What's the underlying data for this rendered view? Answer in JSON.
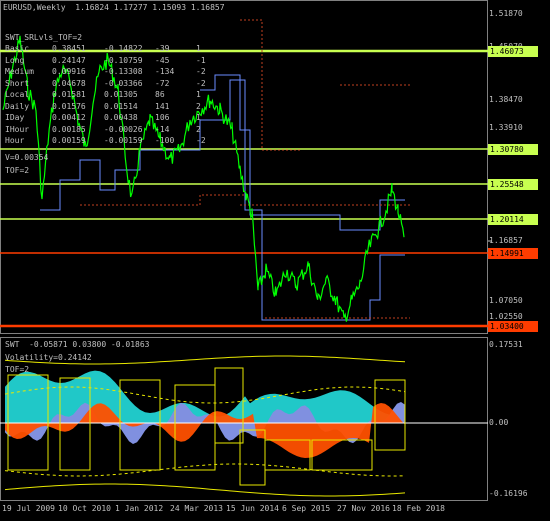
{
  "main_panel": {
    "header": "EURUSD,Weekly  1.16824 1.17277 1.15093 1.16857",
    "indicator_title": "SWT_SRLvls_TOF=2",
    "table_rows": [
      {
        "name": "Basic",
        "c1": "0.38451",
        "c2": "-0.14822",
        "c3": "-39",
        "c4": "1"
      },
      {
        "name": "Long",
        "c1": "0.24147",
        "c2": "-0.10759",
        "c3": "-45",
        "c4": "-1"
      },
      {
        "name": "Medium",
        "c1": "0.09916",
        "c2": "-0.13308",
        "c3": "-134",
        "c4": "-2"
      },
      {
        "name": "Short",
        "c1": "0.04678",
        "c2": "-0.03366",
        "c3": "-72",
        "c4": "-2"
      },
      {
        "name": "Local",
        "c1": "0.01581",
        "c2": "0.01305",
        "c3": "86",
        "c4": "1"
      },
      {
        "name": "Daily",
        "c1": "0.01576",
        "c2": "0.01514",
        "c3": "141",
        "c4": "2"
      },
      {
        "name": "IDay",
        "c1": "0.00412",
        "c2": "0.00438",
        "c3": "106",
        "c4": "1"
      },
      {
        "name": "IHour",
        "c1": "0.00185",
        "c2": "-0.00026",
        "c3": "-14",
        "c4": "2"
      },
      {
        "name": "Hour",
        "c1": "0.00159",
        "c2": "-0.00159",
        "c3": "-100",
        "c4": "-2"
      }
    ],
    "v_line": "V=0.00354",
    "tof_line": "TOF=2",
    "y_ticks": [
      "1.51870",
      "1.45070",
      "1.38470",
      "1.33910",
      "1.16857",
      "1.07050",
      "1.02550"
    ],
    "price_tags": [
      {
        "label": "1.46073",
        "color": "#c8ff50"
      },
      {
        "label": "1.30780",
        "color": "#c8ff50"
      },
      {
        "label": "1.25548",
        "color": "#c8ff50"
      },
      {
        "label": "1.20114",
        "color": "#c8ff50"
      },
      {
        "label": "1.14991",
        "color": "#ff3c00"
      },
      {
        "label": "1.03400",
        "color": "#ff3c00"
      }
    ]
  },
  "sub_panel": {
    "header": "SWT  -0.05871 0.03800 -0.01863",
    "volatility": "Volatility=0.24142",
    "tof": "TOF=2",
    "y_ticks": [
      "0.17531",
      "0.00",
      "-0.16196"
    ]
  },
  "x_axis": [
    "19 Jul 2009",
    "10 Oct 2010",
    "1 Jan 2012",
    "24 Mar 2013",
    "15 Jun 2014",
    "6 Sep 2015",
    "27 Nov 2016",
    "18 Feb 2018"
  ],
  "colors": {
    "price_line": "#00ff00",
    "support": "#c8ff50",
    "resistance": "#ff3c00",
    "blue_step": "#6a8cff",
    "dotted_red": "#c04020",
    "cyan_area": "#20c8c8",
    "orange_area": "#ff5000",
    "blue_area": "#8090e0",
    "yellow": "#e8e800"
  }
}
